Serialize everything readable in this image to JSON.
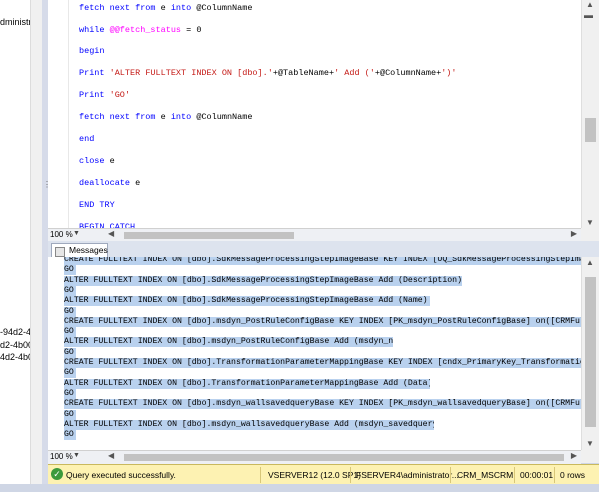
{
  "left_pane": {
    "top_text": "dministrato",
    "items": [
      "-94d2-4b",
      "d2-4b00-",
      "4d2-4b00"
    ]
  },
  "editor": {
    "lines": [
      [
        {
          "t": "fetch next from ",
          "c": "kw"
        },
        {
          "t": "e ",
          "c": ""
        },
        {
          "t": "into ",
          "c": "kw"
        },
        {
          "t": "@ColumnName",
          "c": ""
        }
      ],
      [
        {
          "t": "while ",
          "c": "kw"
        },
        {
          "t": "@@fetch_status",
          "c": "sys"
        },
        {
          "t": " = 0",
          "c": ""
        }
      ],
      [
        {
          "t": "begin",
          "c": "kw"
        }
      ],
      [
        {
          "t": "Print ",
          "c": "kw"
        },
        {
          "t": "'ALTER FULLTEXT INDEX ON [dbo].'",
          "c": "str"
        },
        {
          "t": "+@TableName+",
          "c": ""
        },
        {
          "t": "' Add ('",
          "c": "str"
        },
        {
          "t": "+@ColumnName+",
          "c": ""
        },
        {
          "t": "')'",
          "c": "str"
        }
      ],
      [
        {
          "t": "Print ",
          "c": "kw"
        },
        {
          "t": "'GO'",
          "c": "str"
        }
      ],
      [
        {
          "t": "fetch next from ",
          "c": "kw"
        },
        {
          "t": "e ",
          "c": ""
        },
        {
          "t": "into ",
          "c": "kw"
        },
        {
          "t": "@ColumnName",
          "c": ""
        }
      ],
      [
        {
          "t": "end",
          "c": "kw"
        }
      ],
      [
        {
          "t": "close ",
          "c": "kw"
        },
        {
          "t": "e",
          "c": ""
        }
      ],
      [
        {
          "t": "deallocate ",
          "c": "kw"
        },
        {
          "t": "e",
          "c": ""
        }
      ],
      [
        {
          "t": "END TRY",
          "c": "kw"
        }
      ],
      [
        {
          "t": "BEGIN CATCH",
          "c": "kw"
        }
      ]
    ],
    "zoom": "100 %"
  },
  "messages": {
    "tab_label": "Messages",
    "lines": [
      "CREATE FULLTEXT INDEX ON [dbo].SdkMessageProcessingStepImageBase KEY INDEX [UQ_SdkMessageProcessingStepIma",
      "GO",
      "ALTER FULLTEXT INDEX ON [dbo].SdkMessageProcessingStepImageBase Add (Description)",
      "GO",
      "ALTER FULLTEXT INDEX ON [dbo].SdkMessageProcessingStepImageBase Add (Name)",
      "GO",
      "CREATE FULLTEXT INDEX ON [dbo].msdyn_PostRuleConfigBase KEY INDEX [PK_msdyn_PostRuleConfigBase] on([CRMFul",
      "GO",
      "ALTER FULLTEXT INDEX ON [dbo].msdyn_PostRuleConfigBase Add (msdyn_name)",
      "GO",
      "CREATE FULLTEXT INDEX ON [dbo].TransformationParameterMappingBase KEY INDEX [cndx_PrimaryKey_Transformatio",
      "GO",
      "ALTER FULLTEXT INDEX ON [dbo].TransformationParameterMappingBase Add (Data)",
      "GO",
      "CREATE FULLTEXT INDEX ON [dbo].msdyn_wallsavedqueryBase KEY INDEX [PK_msdyn_wallsavedqueryBase] on([CRMFul",
      "GO",
      "ALTER FULLTEXT INDEX ON [dbo].msdyn_wallsavedqueryBase Add (msdyn_savedqueryname)",
      "GO"
    ],
    "zoom": "100 %"
  },
  "status": {
    "message": "Query executed successfully.",
    "server": "VSERVER12 (12.0 SP1)",
    "user": "FSERVER4\\administrator...",
    "database": "CRM_MSCRM",
    "time": "00:00:01",
    "rows": "0 rows"
  },
  "colors": {
    "keyword": "#0000ff",
    "string": "#c41a16",
    "system": "#ff00ff",
    "selection": "#b9d1ee",
    "status_bg": "#fdf2b2"
  }
}
